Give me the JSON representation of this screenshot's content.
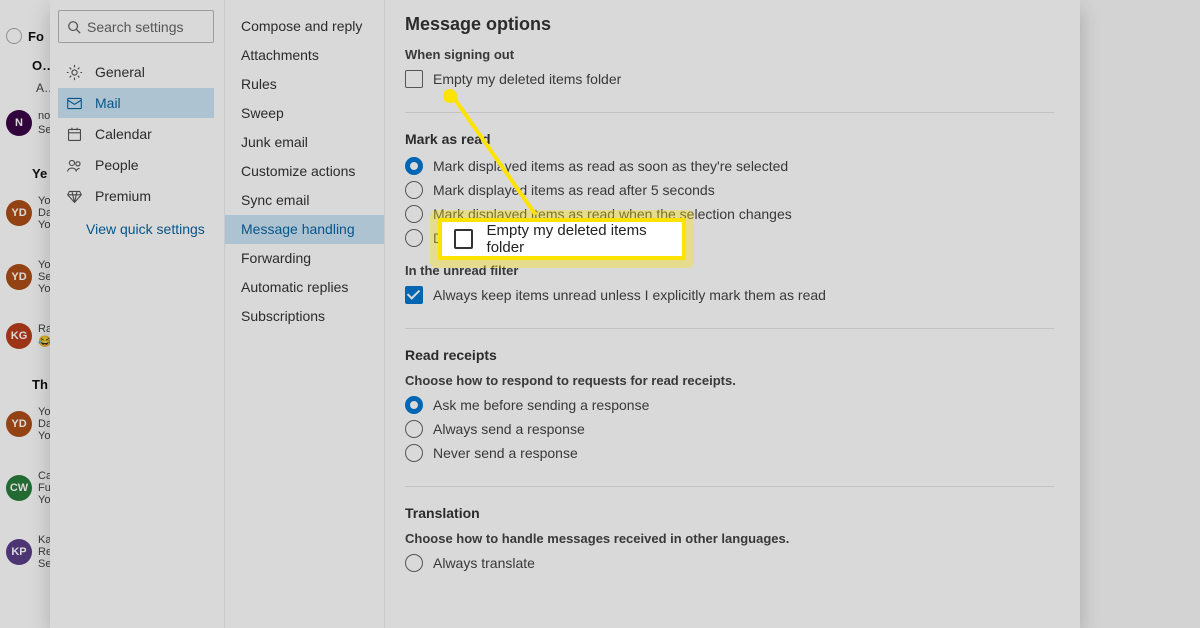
{
  "bg": {
    "filter": "Fo",
    "header1": "O…",
    "header1b": "A…",
    "unread1": "no",
    "unread2": "Se",
    "hdr_yesterday": "Ye",
    "hdr_thursday": "Th",
    "rows": [
      {
        "initials": "YD",
        "lines": [
          "Yo",
          "Da",
          "Yo"
        ]
      },
      {
        "initials": "YD",
        "lines": [
          "Yo",
          "Se",
          "Yo"
        ]
      },
      {
        "initials": "KG",
        "lines": [
          "Ra",
          "😂"
        ]
      },
      {
        "initials": "YD",
        "lines": [
          "Yo",
          "Da",
          "Yo"
        ]
      },
      {
        "initials": "CW",
        "lines": [
          "Ca",
          "Fu",
          "Yo"
        ]
      },
      {
        "initials": "KP",
        "lines": [
          "Ka",
          "Re",
          "Se"
        ]
      }
    ]
  },
  "search": {
    "placeholder": "Search settings"
  },
  "nav1": [
    {
      "id": "general",
      "label": "General"
    },
    {
      "id": "mail",
      "label": "Mail",
      "active": true
    },
    {
      "id": "calendar",
      "label": "Calendar"
    },
    {
      "id": "people",
      "label": "People"
    },
    {
      "id": "premium",
      "label": "Premium"
    }
  ],
  "quick_link": "View quick settings",
  "subnav": [
    {
      "label": "Compose and reply"
    },
    {
      "label": "Attachments"
    },
    {
      "label": "Rules"
    },
    {
      "label": "Sweep"
    },
    {
      "label": "Junk email"
    },
    {
      "label": "Customize actions"
    },
    {
      "label": "Sync email"
    },
    {
      "label": "Message handling",
      "active": true
    },
    {
      "label": "Forwarding"
    },
    {
      "label": "Automatic replies"
    },
    {
      "label": "Subscriptions"
    }
  ],
  "sections": {
    "message_options": {
      "title": "Message options",
      "when_signing_out": "When signing out",
      "empty_deleted": "Empty my deleted items folder"
    },
    "mark_as_read": {
      "title": "Mark as read",
      "r1": "Mark displayed items as read as soon as they're selected",
      "r2": "Mark displayed items as read after 5 seconds",
      "r3": "Mark displayed items as read when the selection changes",
      "r4": "Don't automatically mark items as read",
      "unread_filter": "In the unread filter",
      "always_keep": "Always keep items unread unless I explicitly mark them as read"
    },
    "read_receipts": {
      "title": "Read receipts",
      "desc": "Choose how to respond to requests for read receipts.",
      "r1": "Ask me before sending a response",
      "r2": "Always send a response",
      "r3": "Never send a response"
    },
    "translation": {
      "title": "Translation",
      "desc": "Choose how to handle messages received in other languages.",
      "r1": "Always translate"
    }
  },
  "callout_text": "Empty my deleted items folder",
  "avatar_colors": {
    "N": "#3a0647",
    "YD": "#ad4f17",
    "KG": "#ba3e1c",
    "CW": "#2a7d3b",
    "KP": "#5a3f87"
  }
}
